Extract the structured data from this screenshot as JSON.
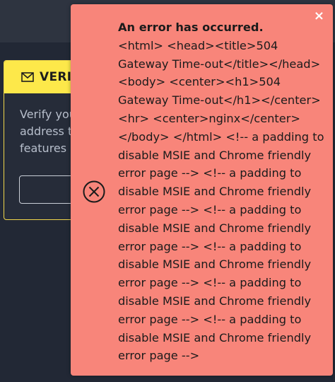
{
  "verify_panel": {
    "title": "VERIFY",
    "text": "Verify your email address to unlock all features"
  },
  "error_toast": {
    "title": "An error has occurred.",
    "message": "<html> <head><title>504 Gateway Time-out</title></head> <body> <center><h1>504 Gateway Time-out</h1></center> <hr> <center>nginx</center> </body> </html> <!-- a padding to disable MSIE and Chrome friendly error page --> <!-- a padding to disable MSIE and Chrome friendly error page --> <!-- a padding to disable MSIE and Chrome friendly error page --> <!-- a padding to disable MSIE and Chrome friendly error page --> <!-- a padding to disable MSIE and Chrome friendly error page --> <!-- a padding to disable MSIE and Chrome friendly error page -->",
    "close_label": "×"
  },
  "colors": {
    "background": "#222835",
    "toast": "#f8857a",
    "verify_header": "#fde84a"
  },
  "icons": {
    "error": "circle-x-icon",
    "verify": "envelope-icon",
    "close": "close-icon"
  }
}
